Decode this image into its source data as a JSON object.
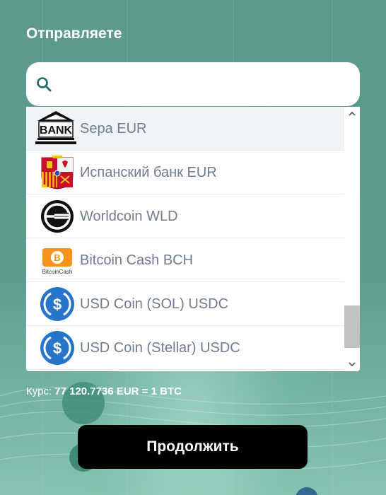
{
  "title": "Отправляете",
  "search": {
    "placeholder": "",
    "value": ""
  },
  "options": [
    {
      "label": "Sepa EUR",
      "icon": "bank-icon",
      "selected": true
    },
    {
      "label": "Испанский банк EUR",
      "icon": "spain-coat-of-arms-icon",
      "selected": false
    },
    {
      "label": "Worldcoin WLD",
      "icon": "worldcoin-icon",
      "selected": false
    },
    {
      "label": "Bitcoin Cash BCH",
      "icon": "bitcoin-cash-icon",
      "selected": false
    },
    {
      "label": "USD Coin (SOL) USDC",
      "icon": "usdc-icon",
      "selected": false
    },
    {
      "label": "USD Coin (Stellar) USDC",
      "icon": "usdc-icon",
      "selected": false
    }
  ],
  "bank_logo_text": "BANK",
  "bitcoin_cash_logo_text": "BitcoinCash",
  "rate": {
    "prefix": "Курс:",
    "value": "77 120.7736 EUR = 1 BTC"
  },
  "continue_label": "Продолжить",
  "colors": {
    "accent": "#5a988c",
    "usdc_blue": "#2775ca",
    "bch_orange": "#f7931a",
    "button": "#000000"
  }
}
